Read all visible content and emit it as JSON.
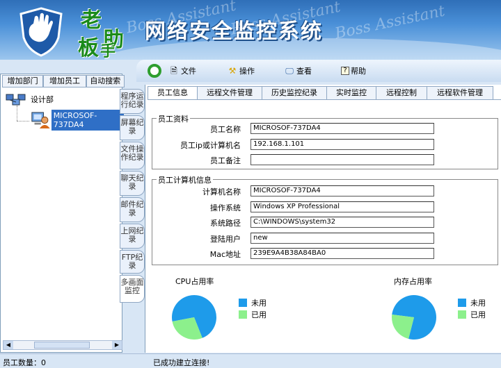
{
  "banner": {
    "brand_chars": [
      "老",
      "板",
      "助",
      "手"
    ],
    "title": "网络安全监控系统",
    "watermark": "Boss Assistant"
  },
  "toolbar": {
    "file_label": "文件",
    "action_label": "操作",
    "view_label": "查看",
    "help_label": "帮助"
  },
  "left_tabs": [
    "增加部门",
    "增加员工",
    "自动搜索"
  ],
  "tree": {
    "department": "设计部",
    "computer": "MICROSOF-737DA4"
  },
  "vertical_tabs": [
    "程序运行纪录",
    "屏幕纪录",
    "文件操作纪录",
    "聊天纪录",
    "邮件纪录",
    "上网纪录",
    "FTP纪录",
    "多画面监控"
  ],
  "main_tabs": [
    "员工信息",
    "远程文件管理",
    "历史监控纪录",
    "实时监控",
    "远程控制",
    "远程软件管理"
  ],
  "employee": {
    "legend": "员工资料",
    "name_label": "员工名称",
    "name_value": "MICROSOF-737DA4",
    "ip_label": "员工ip或计算机名",
    "ip_value": "192.168.1.101",
    "note_label": "员工备注",
    "note_value": ""
  },
  "computer": {
    "legend": "员工计算机信息",
    "name_label": "计算机名称",
    "name_value": "MICROSOF-737DA4",
    "os_label": "操作系统",
    "os_value": "Windows XP Professional",
    "path_label": "系统路径",
    "path_value": "C:\\WINDOWS\\system32",
    "user_label": "登陆用户",
    "user_value": "new",
    "mac_label": "Mac地址",
    "mac_value": "239E9A4B38A84BA0"
  },
  "cpu": {
    "title": "CPU占用率",
    "unused_label": "未用",
    "used_label": "已用"
  },
  "memory": {
    "title": "内存占用率",
    "unused_label": "未用",
    "used_label": "已用"
  },
  "chart_data": [
    {
      "type": "pie",
      "title": "CPU占用率",
      "labels": [
        "未用",
        "已用"
      ],
      "values": [
        0.72,
        0.28
      ],
      "colors": [
        "#1e9bea",
        "#8cf08c"
      ],
      "legend": "right"
    },
    {
      "type": "pie",
      "title": "内存占用率",
      "labels": [
        "未用",
        "已用"
      ],
      "values": [
        0.77,
        0.23
      ],
      "colors": [
        "#1e9bea",
        "#8cf08c"
      ],
      "legend": "right"
    }
  ],
  "status": {
    "count": "员工数量：0",
    "message": "已成功建立连接!"
  }
}
